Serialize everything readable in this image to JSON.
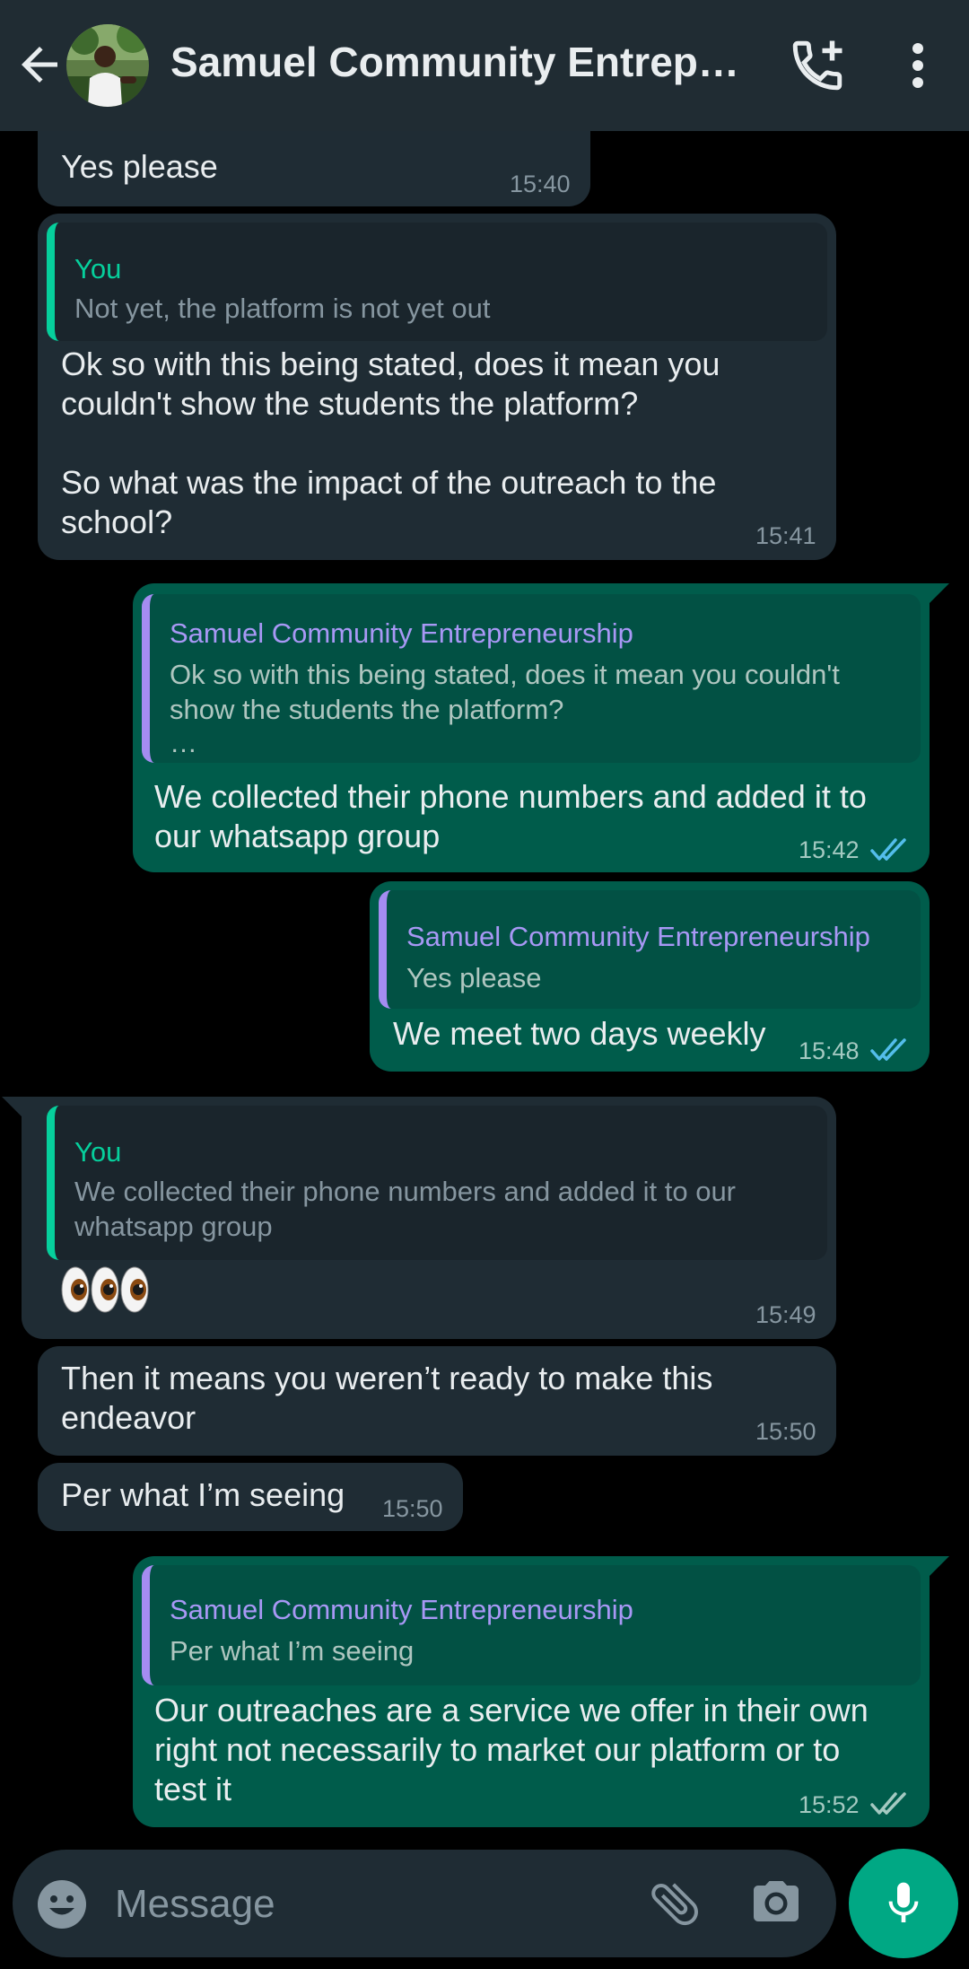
{
  "header": {
    "title": "Samuel Community Entrepre…",
    "icons": [
      "back-arrow-icon",
      "avatar",
      "add-call-icon",
      "more-vert-icon"
    ]
  },
  "messages": [
    {
      "dir": "in",
      "text": [
        "Yes please"
      ],
      "time": "15:40"
    },
    {
      "dir": "in",
      "quote_author": "You",
      "quote_text": [
        "Not yet, the platform is not yet out"
      ],
      "text": [
        "Ok so with this being stated, does it mean you",
        "couldn't show the students the platform?",
        "",
        "So what was the impact of the outreach to the",
        "school?"
      ],
      "time": "15:41"
    },
    {
      "dir": "out",
      "quote_author": "Samuel Community Entrepreneurship",
      "quote_text": [
        "Ok so with this being stated, does it mean you couldn't",
        "show the students the platform?",
        "…"
      ],
      "text": [
        "We collected their phone numbers and added it to",
        "our whatsapp group"
      ],
      "time": "15:42",
      "status": "read"
    },
    {
      "dir": "out",
      "quote_author": "Samuel Community Entrepreneurship",
      "quote_text": [
        "Yes please"
      ],
      "text": [
        "We meet two days weekly"
      ],
      "time": "15:48",
      "status": "read"
    },
    {
      "dir": "in",
      "quote_author": "You",
      "quote_text": [
        "We collected their phone numbers and added it to our",
        "whatsapp group"
      ],
      "text": [
        "👀👀👀"
      ],
      "time": "15:49"
    },
    {
      "dir": "in",
      "text": [
        "Then it means you weren’t ready to make this",
        "endeavor"
      ],
      "time": "15:50"
    },
    {
      "dir": "in",
      "text": [
        "Per what I’m seeing"
      ],
      "time": "15:50"
    },
    {
      "dir": "out",
      "quote_author": "Samuel Community Entrepreneurship",
      "quote_text": [
        "Per what I’m seeing"
      ],
      "text": [
        "Our outreaches are a service we offer in their own",
        "right not necessarily to market our platform or to",
        "test it"
      ],
      "time": "15:52",
      "status": "delivered"
    }
  ],
  "composer": {
    "placeholder": "Message",
    "icons": [
      "emoji-icon",
      "attach-icon",
      "camera-icon",
      "mic-icon"
    ]
  },
  "colors": {
    "header_bg": "#202c33",
    "incoming_bubble": "#1f2c34",
    "outgoing_bubble": "#005c4b",
    "accent_green": "#00a884",
    "read_tick_blue": "#53bdeb",
    "quote_author_incoming": "#06cf9c",
    "quote_author_outgoing": "#a898f5"
  }
}
